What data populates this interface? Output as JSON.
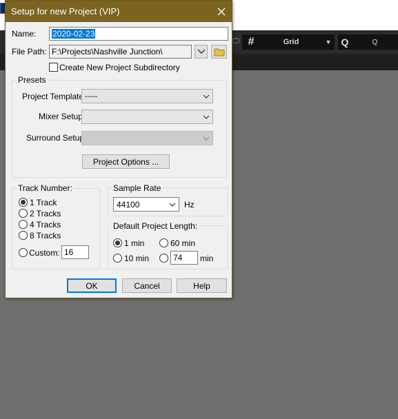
{
  "background": {
    "grid_label": "Grid",
    "grid_icon": "#",
    "quantize_icon": "Q",
    "quantize_label": "Q"
  },
  "dialog": {
    "title": "Setup for new Project (VIP)",
    "name_label": "Name:",
    "name_value": "2020-02-23",
    "filepath_label": "File Path:",
    "filepath_value": "F:\\Projects\\Nashville Junction\\",
    "subdir_label": "Create New Project Subdirectory",
    "subdir_checked": false,
    "presets": {
      "title": "Presets",
      "template_label": "Project Template:",
      "template_value": "-----",
      "mixer_label": "Mixer Setup:",
      "mixer_value": "",
      "surround_label": "Surround Setup:",
      "surround_value": "",
      "options_button": "Project Options ..."
    },
    "track_number": {
      "title": "Track Number:",
      "options": [
        "1 Track",
        "2 Tracks",
        "4 Tracks",
        "8 Tracks"
      ],
      "selected": "1 Track",
      "custom_label": "Custom:",
      "custom_value": "16"
    },
    "sample_rate": {
      "title": "Sample Rate",
      "value": "44100",
      "unit": "Hz"
    },
    "project_length": {
      "title": "Default Project Length:",
      "opt_1min": "1 min",
      "opt_60min": "60 min",
      "opt_10min": "10 min",
      "custom_value": "74",
      "custom_unit": "min",
      "selected": "1 min"
    },
    "buttons": {
      "ok": "OK",
      "cancel": "Cancel",
      "help": "Help"
    }
  },
  "colors": {
    "titlebar": "#7c6320",
    "selection": "#0078d7",
    "dialog_bg": "#f0f0f0"
  }
}
